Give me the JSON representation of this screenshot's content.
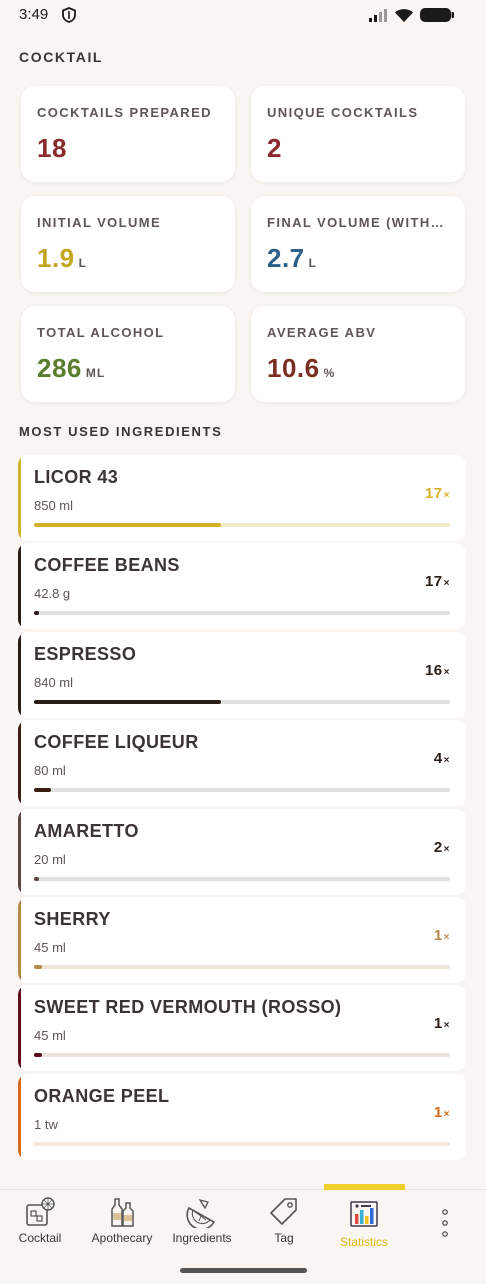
{
  "status_bar": {
    "time": "3:49"
  },
  "cocktail_section": {
    "title": "COCKTAIL",
    "cards": [
      {
        "label": "COCKTAILS PREPARED",
        "value": "18",
        "unit": "",
        "color": "#8a2a2e"
      },
      {
        "label": "UNIQUE COCKTAILS",
        "value": "2",
        "unit": "",
        "color": "#8a2a2e"
      },
      {
        "label": "INITIAL VOLUME",
        "value": "1.9",
        "unit": "L",
        "color": "#c3a51f"
      },
      {
        "label": "FINAL VOLUME (WITHOUT SHAKING)",
        "value": "2.7",
        "unit": "L",
        "color": "#2c5f8a"
      },
      {
        "label": "TOTAL ALCOHOL",
        "value": "286",
        "unit": "ML",
        "color": "#5b7d2d"
      },
      {
        "label": "AVERAGE ABV",
        "value": "10.6",
        "unit": "%",
        "color": "#7a2e22"
      }
    ]
  },
  "ingredients_section": {
    "title": "MOST USED INGREDIENTS",
    "items": [
      {
        "name": "LICOR 43",
        "amount": "850 ml",
        "count": "17",
        "times": "×",
        "level": 0.45,
        "color": "#d4b12a",
        "track": "#f3ebc7"
      },
      {
        "name": "COFFEE BEANS",
        "amount": "42.8 g",
        "count": "17",
        "times": "×",
        "level": 0.01,
        "color": "#2a1d17",
        "track": "#e2e0df"
      },
      {
        "name": "ESPRESSO",
        "amount": "840 ml",
        "count": "16",
        "times": "×",
        "level": 0.45,
        "color": "#2a1d17",
        "track": "#e2e0df"
      },
      {
        "name": "COFFEE LIQUEUR",
        "amount": "80 ml",
        "count": "4",
        "times": "×",
        "level": 0.04,
        "color": "#3b1e10",
        "track": "#e2e0df"
      },
      {
        "name": "AMARETTO",
        "amount": "20 ml",
        "count": "2",
        "times": "×",
        "level": 0.01,
        "color": "#5a4540",
        "track": "#e2e0df"
      },
      {
        "name": "SHERRY",
        "amount": "45 ml",
        "count": "1",
        "times": "×",
        "level": 0.02,
        "color": "#b8894a",
        "track": "#eee5d8"
      },
      {
        "name": "SWEET RED VERMOUTH (ROSSO)",
        "amount": "45 ml",
        "count": "1",
        "times": "×",
        "level": 0.02,
        "color": "#5e0d1c",
        "track": "#ebdfe0"
      },
      {
        "name": "ORANGE PEEL",
        "amount": "1 tw",
        "count": "1",
        "times": "×",
        "level": 0.0,
        "color": "#d66a1a",
        "track": "#f4e6dc"
      }
    ]
  },
  "bottom_nav": {
    "items": [
      {
        "label": "Cocktail",
        "icon": "cocktail-glass-icon"
      },
      {
        "label": "Apothecary",
        "icon": "bottles-icon"
      },
      {
        "label": "Ingredients",
        "icon": "lemon-slice-icon"
      },
      {
        "label": "Tag",
        "icon": "tag-icon"
      },
      {
        "label": "Statistics",
        "icon": "bar-chart-icon",
        "active": true
      }
    ],
    "more_icon": "more-vertical-icon",
    "active_color": "#f1cf2a"
  }
}
